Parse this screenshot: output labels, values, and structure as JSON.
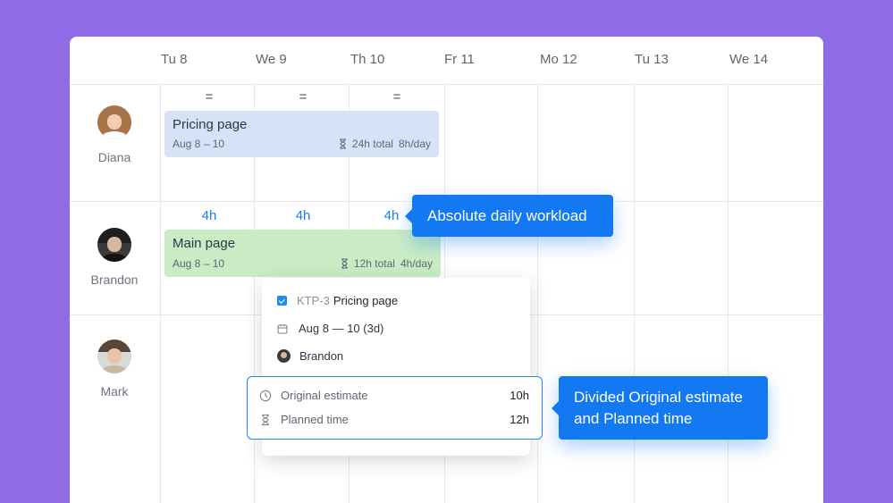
{
  "days": [
    "Tu 8",
    "We 9",
    "Th 10",
    "Fr 11",
    "Mo 12",
    "Tu 13",
    "We 14"
  ],
  "people": [
    {
      "name": "Diana"
    },
    {
      "name": "Brandon"
    },
    {
      "name": "Mark"
    }
  ],
  "diana_row": {
    "workload": [
      "=",
      "=",
      "="
    ],
    "bar": {
      "title": "Pricing page",
      "dates": "Aug 8 – 10",
      "total": "24h total",
      "per_day": "8h/day",
      "color": "#d7e2f7"
    }
  },
  "brandon_row": {
    "workload": [
      "4h",
      "4h",
      "4h"
    ],
    "bar": {
      "title": "Main page",
      "dates": "Aug 8 – 10",
      "total": "12h total",
      "per_day": "4h/day",
      "color": "#c9ecc5"
    }
  },
  "popup": {
    "key": "KTP-3",
    "title": "Pricing page",
    "date_range": "Aug 8 — 10 (3d)",
    "assignee": "Brandon",
    "original_estimate_label": "Original estimate",
    "original_estimate_value": "10h",
    "planned_time_label": "Planned time",
    "planned_time_value": "12h"
  },
  "callouts": {
    "workload": "Absolute daily workload",
    "divided_line1": "Divided Original estimate",
    "divided_line2": "and Planned time"
  },
  "colors": {
    "background": "#8f6be6",
    "accent": "#1279f2"
  }
}
